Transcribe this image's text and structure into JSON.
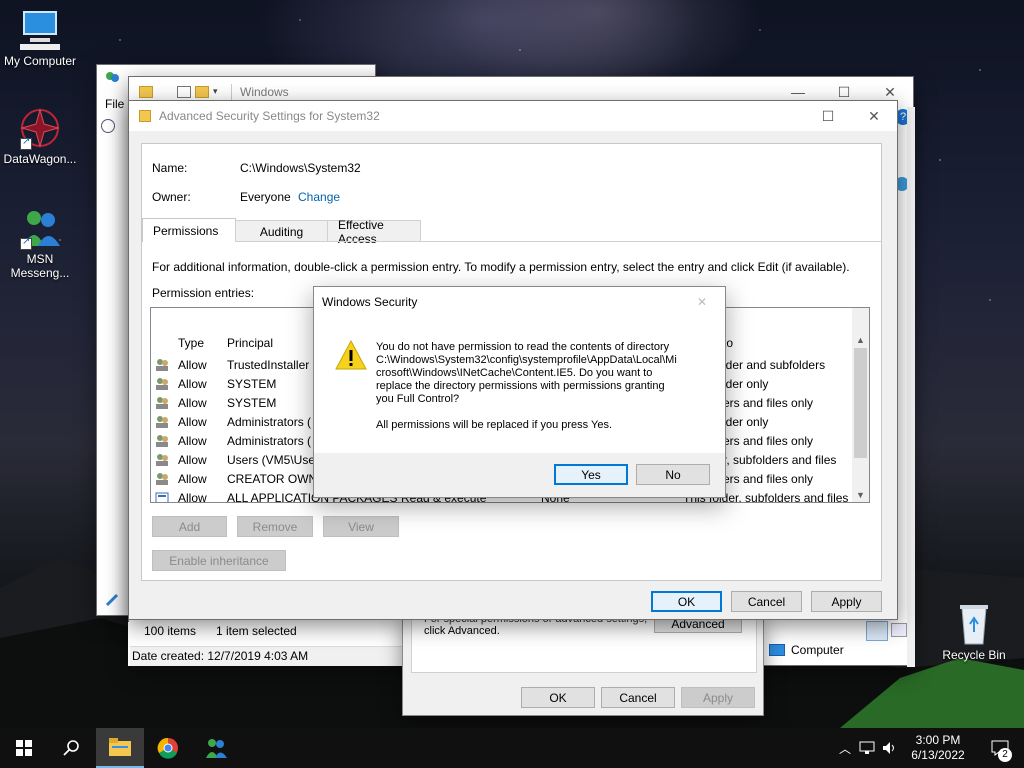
{
  "desktop": {
    "icons": [
      {
        "label": "My Computer"
      },
      {
        "label": "DataWagon..."
      },
      {
        "label": "MSN Messeng..."
      },
      {
        "label": "Recycle Bin"
      }
    ]
  },
  "explorer": {
    "title": "Windows",
    "menu_file": "File",
    "status_items": "100 items",
    "status_selected": "1 item selected",
    "date_created": "Date created: 12/7/2019 4:03 AM",
    "computer_label": "Computer"
  },
  "advanced": {
    "title": "Advanced Security Settings for System32",
    "name_label": "Name:",
    "name_value": "C:\\Windows\\System32",
    "owner_label": "Owner:",
    "owner_value": "Everyone",
    "change_link": "Change",
    "tabs": [
      "Permissions",
      "Auditing",
      "Effective Access"
    ],
    "info_text": "For additional information, double-click a permission entry. To modify a permission entry, select the entry and click Edit (if available).",
    "entries_label": "Permission entries:",
    "columns": {
      "type": "Type",
      "principal": "Principal",
      "applies": "to"
    },
    "rows": [
      {
        "type": "Allow",
        "principal": "TrustedInstaller",
        "access": "",
        "inherited": "",
        "applies": "lder and subfolders"
      },
      {
        "type": "Allow",
        "principal": "SYSTEM",
        "access": "",
        "inherited": "",
        "applies": "lder only"
      },
      {
        "type": "Allow",
        "principal": "SYSTEM",
        "access": "",
        "inherited": "",
        "applies": "ers and files only"
      },
      {
        "type": "Allow",
        "principal": "Administrators (",
        "access": "",
        "inherited": "",
        "applies": "lder only"
      },
      {
        "type": "Allow",
        "principal": "Administrators (",
        "access": "",
        "inherited": "",
        "applies": "ers and files only"
      },
      {
        "type": "Allow",
        "principal": "Users (VM5\\User",
        "access": "",
        "inherited": "",
        "applies": "r, subfolders and files"
      },
      {
        "type": "Allow",
        "principal": "CREATOR OWNE",
        "access": "",
        "inherited": "",
        "applies": "ers and files only"
      },
      {
        "type": "Allow",
        "principal": "ALL APPLICATION PACKAGES",
        "access": "Read & execute",
        "inherited": "None",
        "applies": "This folder, subfolders and files"
      }
    ],
    "add_btn": "Add",
    "remove_btn": "Remove",
    "view_btn": "View",
    "enable_inheritance_btn": "Enable inheritance",
    "ok_btn": "OK",
    "cancel_btn": "Cancel",
    "apply_btn": "Apply"
  },
  "properties": {
    "special_text_1": "For special permissions or advanced settings,",
    "special_text_2": "click Advanced.",
    "advanced_btn": "Advanced",
    "ok_btn": "OK",
    "cancel_btn": "Cancel",
    "apply_btn": "Apply"
  },
  "security_dialog": {
    "title": "Windows Security",
    "message_lines": [
      "You do not have permission to read the contents of directory",
      "C:\\Windows\\System32\\config\\systemprofile\\AppData\\Local\\Mi",
      "crosoft\\Windows\\INetCache\\Content.IE5. Do you want to",
      "replace the directory permissions with permissions granting",
      "you Full Control?"
    ],
    "note": "All permissions will be replaced if you press Yes.",
    "yes_btn": "Yes",
    "no_btn": "No"
  },
  "taskbar": {
    "time": "3:00 PM",
    "date": "6/13/2022",
    "notification_count": "2"
  },
  "colors": {
    "accent": "#0078d7",
    "link": "#0063b1",
    "warning": "#f7d21c"
  }
}
